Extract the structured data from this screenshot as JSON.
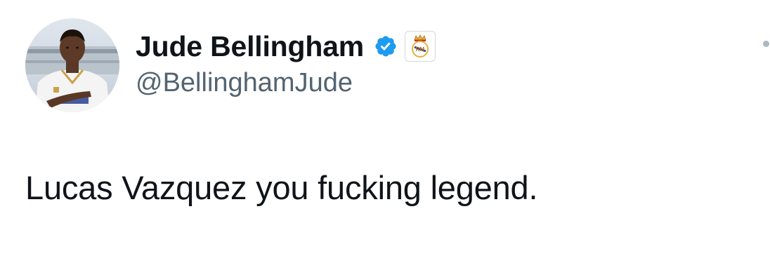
{
  "tweet": {
    "author": {
      "display_name": "Jude Bellingham",
      "handle": "@BellinghamJude",
      "verified": true,
      "affiliate_badge": "real-madrid-crest-icon"
    },
    "text": "Lucas Vazquez you fucking legend.",
    "menu_icon": "more-options-icon"
  },
  "colors": {
    "verified_blue": "#1d9bf0",
    "text_primary": "#0f1419",
    "text_secondary": "#536471",
    "background": "#ffffff"
  }
}
